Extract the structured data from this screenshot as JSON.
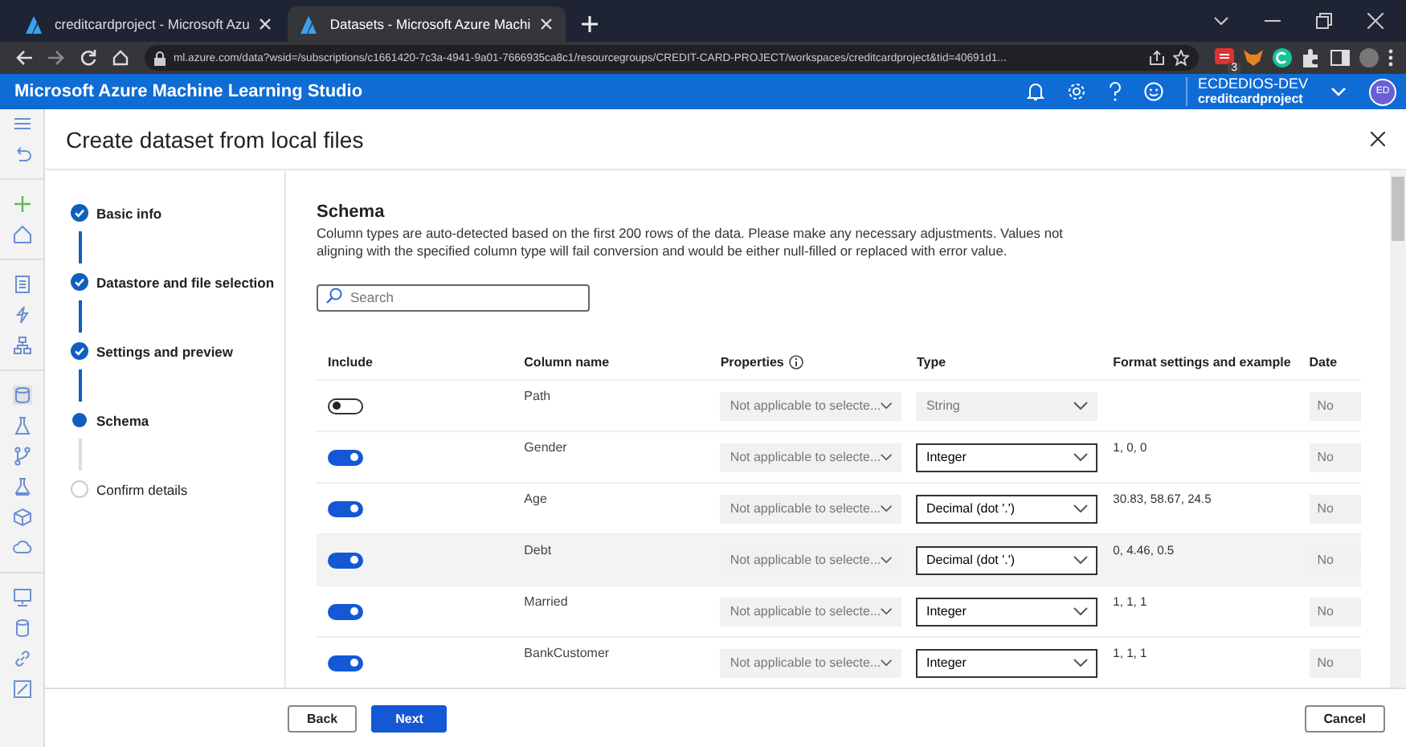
{
  "browser": {
    "tabs": [
      {
        "title": "creditcardproject - Microsoft Azu",
        "selected": false
      },
      {
        "title": "Datasets - Microsoft Azure Machi",
        "selected": true
      }
    ],
    "address": "ml.azure.com/data?wsid=/subscriptions/c1661420-7c3a-4941-9a01-7666935ca8c1/resourcegroups/CREDIT-CARD-PROJECT/workspaces/creditcardproject&tid=40691d1...",
    "extension_badge": "3"
  },
  "app_bar": {
    "title": "Microsoft Azure Machine Learning Studio",
    "account": "ECDEDIOS-DEV",
    "workspace": "creditcardproject",
    "avatar": "ED"
  },
  "dialog": {
    "title": "Create dataset from local files",
    "steps": [
      {
        "label": "Basic info",
        "completed": true,
        "current": false
      },
      {
        "label": "Datastore and file selection",
        "completed": true,
        "current": false
      },
      {
        "label": "Settings and preview",
        "completed": true,
        "current": false
      },
      {
        "label": "Schema",
        "completed": false,
        "current": true
      },
      {
        "label": "Confirm details",
        "completed": false,
        "current": false
      }
    ],
    "heading": "Schema",
    "description": "Column types are auto-detected based on the first 200 rows of the data. Please make any necessary adjustments. Values not aligning with the specified column type will fail conversion and would be either null-filled or replaced with error value.",
    "search": {
      "placeholder": "Search"
    },
    "table": {
      "columns": [
        "Include",
        "Column name",
        "Properties",
        "Type",
        "Format settings and example",
        "Date"
      ],
      "rows": [
        {
          "included": false,
          "name": "Path",
          "properties": "Not applicable to selecte...",
          "type": "String",
          "type_disabled": true,
          "example": "",
          "date": "No",
          "hovered": false
        },
        {
          "included": true,
          "name": "Gender",
          "properties": "Not applicable to selecte...",
          "type": "Integer",
          "type_disabled": false,
          "example": "1, 0, 0",
          "date": "No",
          "hovered": false
        },
        {
          "included": true,
          "name": "Age",
          "properties": "Not applicable to selecte...",
          "type": "Decimal (dot '.')",
          "type_disabled": false,
          "example": "30.83, 58.67, 24.5",
          "date": "No",
          "hovered": false
        },
        {
          "included": true,
          "name": "Debt",
          "properties": "Not applicable to selecte...",
          "type": "Decimal (dot '.')",
          "type_disabled": false,
          "example": "0, 4.46, 0.5",
          "date": "No",
          "hovered": true
        },
        {
          "included": true,
          "name": "Married",
          "properties": "Not applicable to selecte...",
          "type": "Integer",
          "type_disabled": false,
          "example": "1, 1, 1",
          "date": "No",
          "hovered": false
        },
        {
          "included": true,
          "name": "BankCustomer",
          "properties": "Not applicable to selecte...",
          "type": "Integer",
          "type_disabled": false,
          "example": "1, 1, 1",
          "date": "No",
          "hovered": false
        }
      ]
    },
    "buttons": {
      "back": "Back",
      "next": "Next",
      "cancel": "Cancel"
    }
  }
}
